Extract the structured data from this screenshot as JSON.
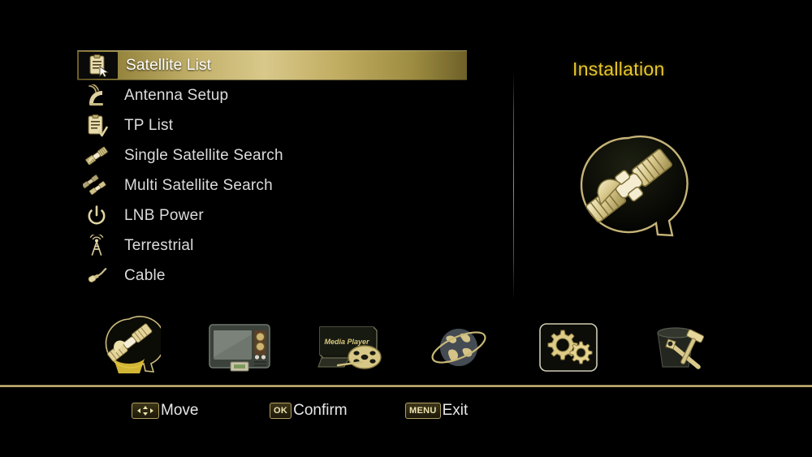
{
  "panel": {
    "title": "Installation",
    "art_icon": "satellite-bubble-icon"
  },
  "menu": {
    "selected_index": 0,
    "items": [
      {
        "label": "Satellite List",
        "icon": "clipboard-cursor-icon"
      },
      {
        "label": "Antenna Setup",
        "icon": "antenna-dish-icon"
      },
      {
        "label": "TP List",
        "icon": "clipboard-check-icon"
      },
      {
        "label": "Single Satellite Search",
        "icon": "satellite-icon"
      },
      {
        "label": "Multi Satellite Search",
        "icon": "double-satellite-icon"
      },
      {
        "label": "LNB Power",
        "icon": "power-icon"
      },
      {
        "label": "Terrestrial",
        "icon": "broadcast-tower-icon"
      },
      {
        "label": "Cable",
        "icon": "cable-connector-icon"
      }
    ]
  },
  "toolbar": {
    "active_index": 0,
    "items": [
      {
        "name": "installation",
        "icon": "satellite-bubble-icon"
      },
      {
        "name": "channel",
        "icon": "tv-icon"
      },
      {
        "name": "media-player",
        "icon": "media-player-icon",
        "screen_label": "Media Player"
      },
      {
        "name": "network",
        "icon": "globe-orbit-icon"
      },
      {
        "name": "system-setup",
        "icon": "gears-icon"
      },
      {
        "name": "tools",
        "icon": "toolbox-icon"
      }
    ]
  },
  "helpbar": {
    "items": [
      {
        "key": "◄▲▼►",
        "key_type": "arrows",
        "label": "Move"
      },
      {
        "key": "OK",
        "key_type": "text",
        "label": "Confirm"
      },
      {
        "key": "MENU",
        "key_type": "text",
        "label": "Exit"
      }
    ]
  },
  "colors": {
    "background": "#000000",
    "highlight_gold": "#d8c88a",
    "title_gold": "#e8c828",
    "text": "#dcdcdc",
    "divider_gold": "#c5b174"
  }
}
